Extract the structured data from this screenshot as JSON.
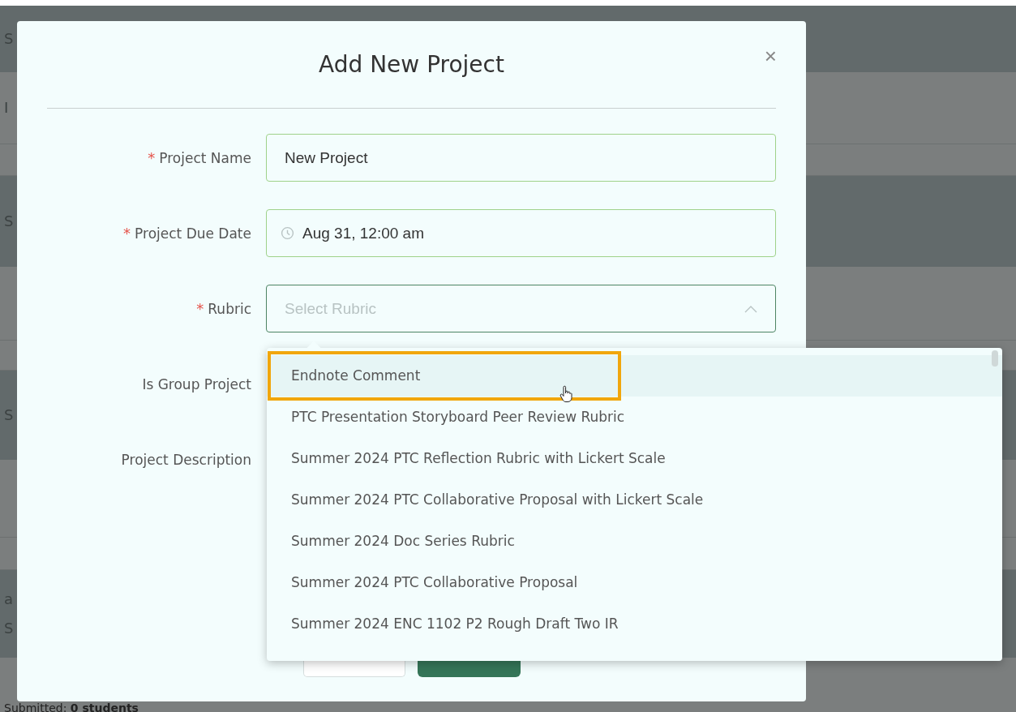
{
  "background": {
    "bands": [
      {
        "kind": "dark",
        "texts": [
          "S"
        ]
      },
      {
        "kind": "light",
        "texts": [
          "I"
        ]
      },
      {
        "kind": "light"
      },
      {
        "kind": "dark",
        "texts": [
          "S"
        ]
      },
      {
        "kind": "light"
      },
      {
        "kind": "light"
      },
      {
        "kind": "dark",
        "texts": [
          "S"
        ]
      },
      {
        "kind": "light"
      },
      {
        "kind": "light"
      },
      {
        "kind": "dark",
        "texts": [
          "a",
          "S"
        ]
      },
      {
        "kind": "light",
        "texts": [
          "Submitted: **0 students**"
        ]
      }
    ]
  },
  "dialog": {
    "title": "Add New Project",
    "close": "×",
    "fields": [
      {
        "kind": "text",
        "label": "Project Name",
        "required": true,
        "value": "New Project"
      },
      {
        "kind": "date",
        "label": "Project Due Date",
        "required": true,
        "value": "Aug 31, 12:00 am"
      },
      {
        "kind": "select",
        "label": "Rubric",
        "required": true,
        "placeholder": "Select Rubric",
        "expanded": true
      },
      {
        "kind": "toggle",
        "label": "Is Group Project",
        "required": false
      },
      {
        "kind": "textarea",
        "label": "Project Description",
        "required": false
      }
    ],
    "required_mark": "*"
  },
  "dropdown": {
    "options": [
      {
        "label": "Endnote Comment",
        "hovered": true,
        "highlighted": true
      },
      {
        "label": "PTC Presentation Storyboard Peer Review Rubric",
        "hovered": false,
        "highlighted": false
      },
      {
        "label": "Summer 2024 PTC Reflection Rubric with Lickert Scale",
        "hovered": false,
        "highlighted": false
      },
      {
        "label": "Summer 2024 PTC Collaborative Proposal with Lickert Scale",
        "hovered": false,
        "highlighted": false
      },
      {
        "label": "Summer 2024 Doc Series Rubric",
        "hovered": false,
        "highlighted": false
      },
      {
        "label": "Summer 2024 PTC Collaborative Proposal",
        "hovered": false,
        "highlighted": false
      },
      {
        "label": "Summer 2024 ENC 1102 P2 Rough Draft Two IR",
        "hovered": false,
        "highlighted": false
      }
    ]
  }
}
